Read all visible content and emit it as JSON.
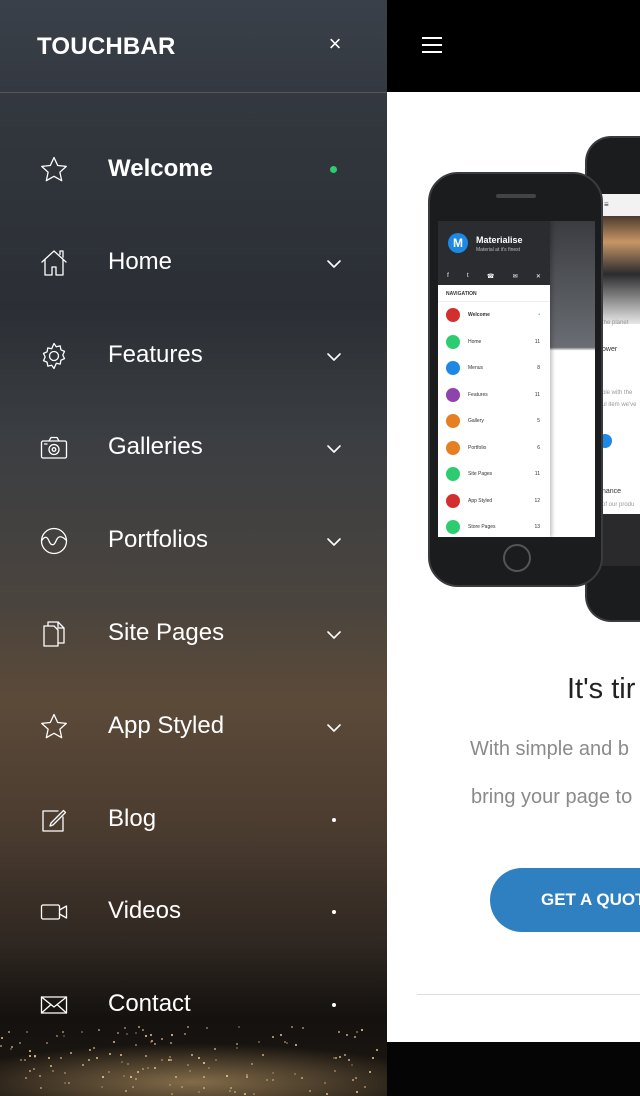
{
  "sidebar": {
    "brand": "TOUCHBAR",
    "close_label": "×",
    "accent_active": "#2ecc71",
    "items": [
      {
        "label": "Welcome",
        "icon": "star-icon",
        "indicator": "green-dot",
        "active": true
      },
      {
        "label": "Home",
        "icon": "home-icon",
        "indicator": "chevron-down"
      },
      {
        "label": "Features",
        "icon": "gear-icon",
        "indicator": "chevron-down"
      },
      {
        "label": "Galleries",
        "icon": "camera-icon",
        "indicator": "chevron-down"
      },
      {
        "label": "Portfolios",
        "icon": "wave-circle-icon",
        "indicator": "chevron-down"
      },
      {
        "label": "Site Pages",
        "icon": "documents-icon",
        "indicator": "chevron-down"
      },
      {
        "label": "App Styled",
        "icon": "star-icon",
        "indicator": "chevron-down"
      },
      {
        "label": "Blog",
        "icon": "edit-icon",
        "indicator": "dot"
      },
      {
        "label": "Videos",
        "icon": "video-camera-icon",
        "indicator": "dot"
      },
      {
        "label": "Contact",
        "icon": "envelope-icon",
        "indicator": "dot"
      }
    ]
  },
  "page": {
    "menu_icon": "hamburger-icon",
    "hero_title": "It's tir",
    "hero_line_1": "With simple and b",
    "hero_line_2": "bring your page to",
    "cta_label": "GET A QUOTE",
    "cta_color": "#2f80c0"
  },
  "phone_preview": {
    "brand": "Materialise",
    "tagline": "Material at it's finest",
    "nav_title": "NAVIGATION",
    "items": [
      {
        "label": "Welcome",
        "count": "•",
        "color": "#d32f2f"
      },
      {
        "label": "Home",
        "count": "11",
        "color": "#2ecc71"
      },
      {
        "label": "Menus",
        "count": "8",
        "color": "#1e88e5"
      },
      {
        "label": "Features",
        "count": "11",
        "color": "#8e44ad"
      },
      {
        "label": "Gallery",
        "count": "5",
        "color": "#e67e22"
      },
      {
        "label": "Portfolio",
        "count": "6",
        "color": "#e67e22"
      },
      {
        "label": "Site Pages",
        "count": "11",
        "color": "#2ecc71"
      },
      {
        "label": "App Styled",
        "count": "12",
        "color": "#d32f2f"
      },
      {
        "label": "Store Pages",
        "count": "13",
        "color": "#2ecc71"
      }
    ],
    "back_text_1": "the planet",
    "back_text_2": "ower",
    "back_text_3": "ble with the",
    "back_text_4": "ul item we've",
    "back_text_5": "nance",
    "back_text_6": "of our produ"
  }
}
